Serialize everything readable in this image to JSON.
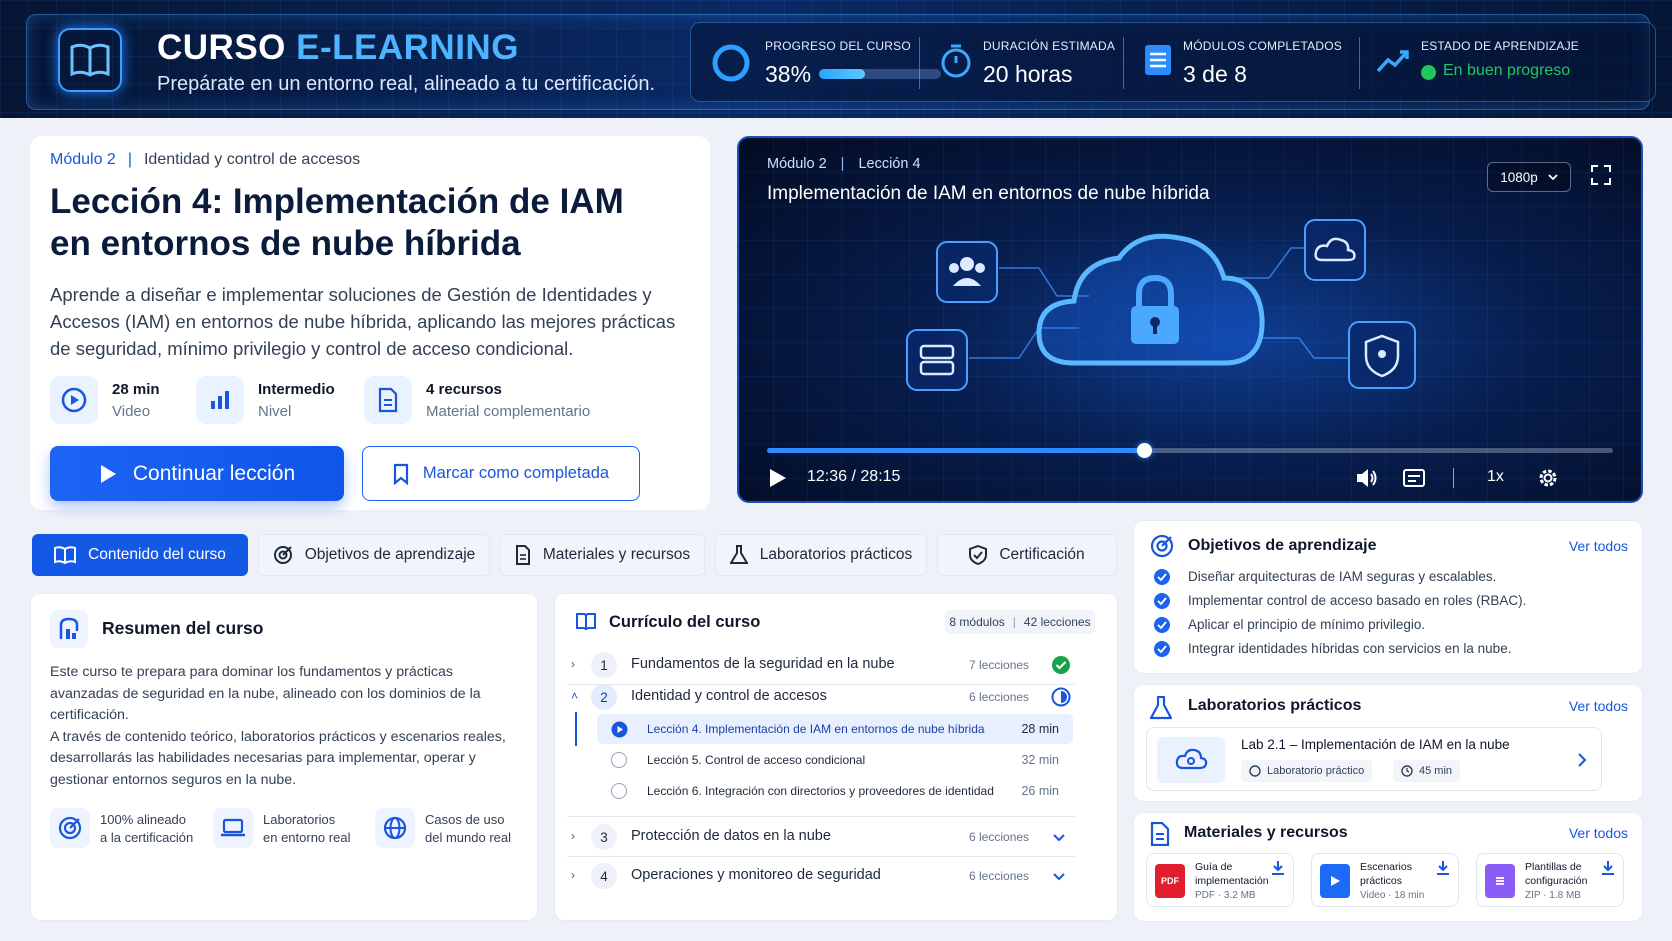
{
  "header": {
    "title_a": "CURSO",
    "title_b": "E-LEARNING",
    "subtitle": "Prepárate en un entorno real, alineado a tu certificación.",
    "stats": {
      "progress_label": "PROGRESO DEL CURSO",
      "progress_value": "38%",
      "progress_fraction": 0.38,
      "duration_label": "DURACIÓN ESTIMADA",
      "duration_value": "20 horas",
      "modules_label": "MÓDULOS COMPLETADOS",
      "modules_value": "3 de 8",
      "status_label": "ESTADO DE APRENDIZAJE",
      "status_value": "En buen progreso",
      "status_color": "#22c55e"
    }
  },
  "lesson": {
    "module": "Módulo 2",
    "module_name": "Identidad y control de accesos",
    "title_line1": "Lección 4: Implementación de IAM",
    "title_line2": "en entornos de nube híbrida",
    "description": "Aprende a diseñar e implementar soluciones de Gestión de Identidades y Accesos (IAM) en entornos de nube híbrida, aplicando las mejores prácticas de seguridad, mínimo privilegio y control de acceso condicional.",
    "meta": [
      {
        "value": "28 min",
        "label": "Video",
        "icon": "play-circle-icon"
      },
      {
        "value": "Intermedio",
        "label": "Nivel",
        "icon": "bar-chart-icon"
      },
      {
        "value": "4 recursos",
        "label": "Material complementario",
        "icon": "document-icon"
      }
    ],
    "continue_label": "Continuar lección",
    "complete_label": "Marcar como completada"
  },
  "video": {
    "module": "Módulo 2",
    "lesson": "Lección 4",
    "title": "Implementación de IAM en entornos de nube híbrida",
    "quality": "1080p",
    "current_time": "12:36",
    "total_time": "28:15",
    "time_separator": "/",
    "progress_fraction": 0.4459,
    "speed": "1x"
  },
  "tabs": [
    {
      "label": "Contenido del curso",
      "icon": "book-icon",
      "active": true
    },
    {
      "label": "Objetivos de aprendizaje",
      "icon": "target-icon",
      "active": false
    },
    {
      "label": "Materiales y recursos",
      "icon": "document-icon",
      "active": false
    },
    {
      "label": "Laboratorios prácticos",
      "icon": "flask-icon",
      "active": false
    },
    {
      "label": "Certificación",
      "icon": "shield-icon",
      "active": false
    }
  ],
  "summary": {
    "title": "Resumen del curso",
    "text_1": "Este curso te prepara para dominar los fundamentos y prácticas avanzadas de seguridad en la nube, alineado con los dominios de la certificación.",
    "text_2": "A través de contenido teórico, laboratorios prácticos y escenarios reales, desarrollarás las habilidades necesarias para implementar, operar y gestionar entornos seguros en la nube.",
    "features": [
      {
        "line1": "100% alineado",
        "line2": "a la certificación",
        "icon": "target-icon"
      },
      {
        "line1": "Laboratorios",
        "line2": "en entorno real",
        "icon": "laptop-icon"
      },
      {
        "line1": "Casos de uso",
        "line2": "del mundo real",
        "icon": "globe-icon"
      }
    ]
  },
  "curriculum": {
    "title": "Currículo del curso",
    "modules_count": "8 módulos",
    "lessons_count": "42 lecciones",
    "modules": [
      {
        "num": "1",
        "name": "Fundamentos de la seguridad en la nube",
        "count": "7 lecciones",
        "status": "completed"
      },
      {
        "num": "2",
        "name": "Identidad y control de accesos",
        "count": "6 lecciones",
        "status": "in-progress"
      },
      {
        "num": "3",
        "name": "Protección de datos en la nube",
        "count": "6 lecciones",
        "status": "collapsed"
      },
      {
        "num": "4",
        "name": "Operaciones y monitoreo de seguridad",
        "count": "6 lecciones",
        "status": "collapsed"
      }
    ],
    "lessons": [
      {
        "name": "Lección 4. Implementación de IAM en entornos de nube híbrida",
        "duration": "28 min",
        "current": true
      },
      {
        "name": "Lección 5. Control de acceso condicional",
        "duration": "32 min",
        "current": false
      },
      {
        "name": "Lección 6. Integración con directorios y proveedores de identidad",
        "duration": "26 min",
        "current": false
      }
    ]
  },
  "objectives": {
    "title": "Objetivos de aprendizaje",
    "see_all": "Ver todos",
    "items": [
      "Diseñar arquitecturas de IAM seguras y escalables.",
      "Implementar control de acceso basado en roles (RBAC).",
      "Aplicar el principio de mínimo privilegio.",
      "Integrar identidades híbridas con servicios en la nube."
    ]
  },
  "labs": {
    "title": "Laboratorios prácticos",
    "see_all": "Ver todos",
    "lab_name": "Lab 2.1 – Implementación de IAM en la nube",
    "lab_type": "Laboratorio práctico",
    "lab_duration": "45 min"
  },
  "materials": {
    "title": "Materiales y recursos",
    "see_all": "Ver todos",
    "items": [
      {
        "line1": "Guía de",
        "line2": "implementación",
        "meta": "PDF · 3.2 MB",
        "badge": "PDF",
        "color": "#e11d2e"
      },
      {
        "line1": "Escenarios",
        "line2": "prácticos",
        "meta": "Video · 18 min",
        "badge": "",
        "color": "#1d6af5"
      },
      {
        "line1": "Plantillas de",
        "line2": "configuración",
        "meta": "ZIP · 1.8 MB",
        "badge": "",
        "color": "#8b5cf6"
      }
    ]
  }
}
